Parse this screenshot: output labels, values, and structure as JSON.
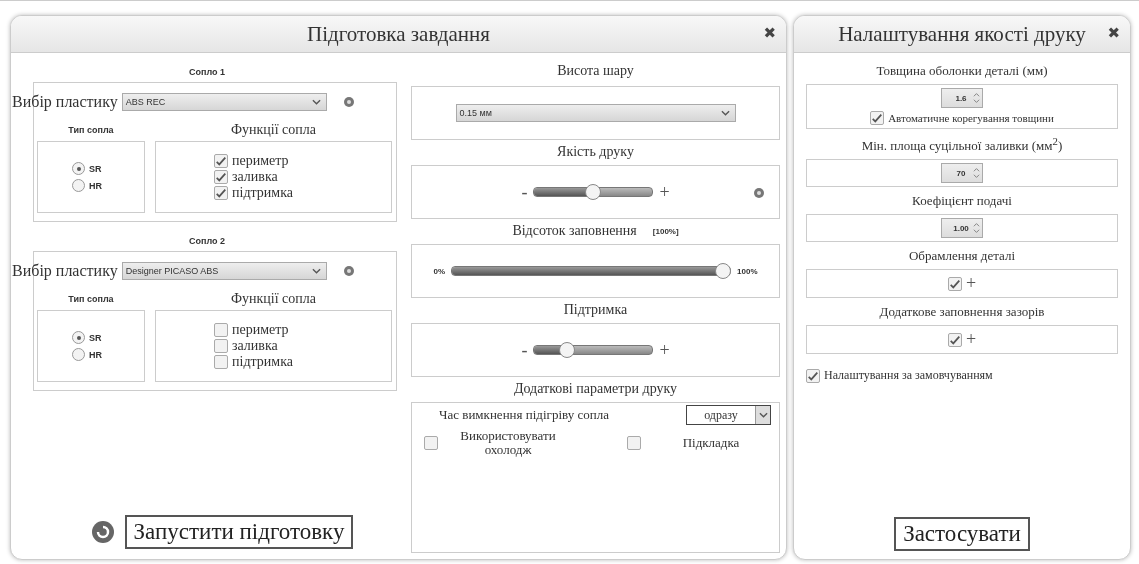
{
  "main_panel": {
    "title": "Підготовка завдання",
    "close": "✖",
    "nozzles": [
      {
        "title": "Сопло 1",
        "plastic_label": "Вибір пластику",
        "plastic": "ABS REC",
        "type_label": "Тип сопла",
        "types": [
          {
            "label": "SR",
            "selected": true
          },
          {
            "label": "HR",
            "selected": false
          }
        ],
        "functions_label": "Функції сопла",
        "functions": [
          {
            "label": "периметр",
            "checked": true
          },
          {
            "label": "заливка",
            "checked": true
          },
          {
            "label": "підтримка",
            "checked": true
          }
        ]
      },
      {
        "title": "Сопло 2",
        "plastic_label": "Вибір пластику",
        "plastic": "Designer PICASO ABS",
        "type_label": "Тип сопла",
        "types": [
          {
            "label": "SR",
            "selected": true
          },
          {
            "label": "HR",
            "selected": false
          }
        ],
        "functions_label": "Функції сопла",
        "functions": [
          {
            "label": "периметр",
            "checked": false
          },
          {
            "label": "заливка",
            "checked": false
          },
          {
            "label": "підтримка",
            "checked": false
          }
        ]
      }
    ],
    "start_button": "Запустити підготовку"
  },
  "print_settings": {
    "layer_height": {
      "title": "Висота шару",
      "value": "0.15 мм"
    },
    "quality": {
      "title": "Якість друку",
      "minus": "-",
      "plus": "+",
      "level": 0.5
    },
    "infill": {
      "title": "Відсоток заповнення",
      "reading": "[100%]",
      "min": "0%",
      "max": "100%",
      "level": 1
    },
    "support": {
      "title": "Підтримка",
      "minus": "-",
      "plus": "+",
      "level": 0.25
    },
    "extra": {
      "title": "Додаткові параметри друку",
      "cooldown_label": "Час вимкнення підігріву сопла",
      "cooldown": "одразу",
      "options": [
        {
          "label": "Використовувати охолодж",
          "checked": false
        },
        {
          "label": "Підкладка",
          "checked": false
        }
      ]
    }
  },
  "quality_panel": {
    "title": "Налаштування якості друку",
    "close": "✖",
    "sections": [
      {
        "kind": "spinner",
        "title": "Товщина оболонки деталі (мм)",
        "value": "1.6",
        "option": {
          "label": "Автоматичне корегування товщини",
          "checked": true
        }
      },
      {
        "kind": "spinner",
        "title": "Мін. площа суцільної заливки (мм$^{2}$)",
        "value": "70"
      },
      {
        "kind": "spinner",
        "title": "Коефіцієнт подачі",
        "value": "1.00"
      },
      {
        "kind": "toggle",
        "title": "Обрамлення деталі",
        "checked": true,
        "plus": "+"
      },
      {
        "kind": "toggle",
        "title": "Додаткове заповнення зазорів",
        "checked": true,
        "plus": "+"
      }
    ],
    "defaults": {
      "label": "Налаштування за замовчуванням",
      "checked": true
    },
    "apply_button": "Застосувати"
  }
}
